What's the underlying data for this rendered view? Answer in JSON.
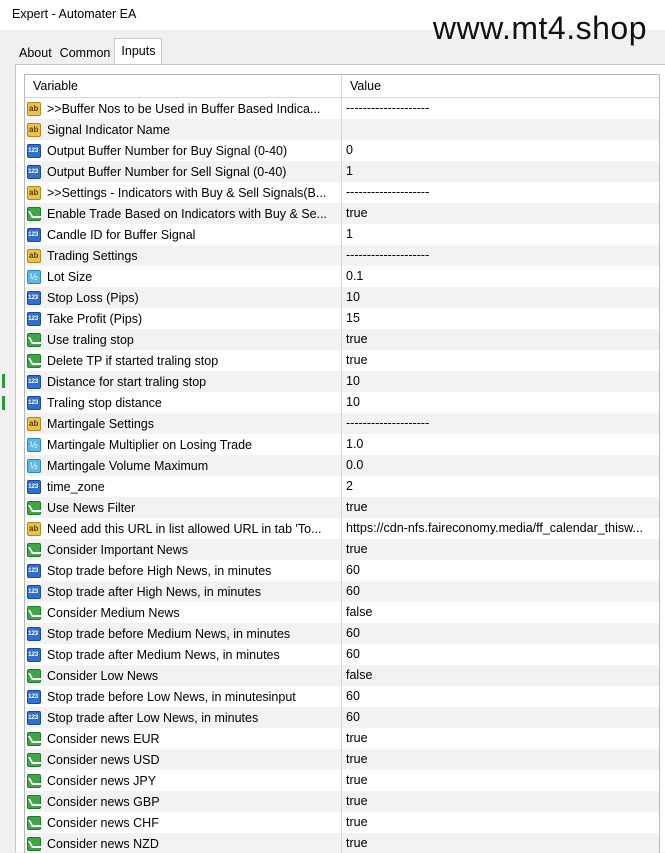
{
  "window": {
    "title": "Expert - Automater EA"
  },
  "watermark": "www.mt4.shop",
  "tabs": [
    {
      "label": "About",
      "active": false
    },
    {
      "label": "Common",
      "active": false
    },
    {
      "label": "Inputs",
      "active": true
    }
  ],
  "table": {
    "headers": {
      "variable": "Variable",
      "value": "Value"
    },
    "rows": [
      {
        "icon": "text",
        "variable": ">>Buffer Nos to be Used in Buffer Based Indica...",
        "value": "--------------------"
      },
      {
        "icon": "text",
        "variable": "Signal Indicator Name",
        "value": ""
      },
      {
        "icon": "int",
        "variable": "Output Buffer Number for Buy Signal (0-40)",
        "value": "0"
      },
      {
        "icon": "int",
        "variable": "Output Buffer Number for Sell Signal (0-40)",
        "value": "1"
      },
      {
        "icon": "text",
        "variable": ">>Settings - Indicators with Buy & Sell Signals(B...",
        "value": "--------------------"
      },
      {
        "icon": "bool",
        "variable": "Enable Trade Based on Indicators with Buy & Se...",
        "value": "true"
      },
      {
        "icon": "int",
        "variable": "Candle ID for Buffer Signal",
        "value": "1"
      },
      {
        "icon": "text",
        "variable": "Trading Settings",
        "value": "--------------------"
      },
      {
        "icon": "double",
        "variable": "Lot Size",
        "value": "0.1"
      },
      {
        "icon": "int",
        "variable": "Stop Loss (Pips)",
        "value": "10"
      },
      {
        "icon": "int",
        "variable": "Take Profit (Pips)",
        "value": "15"
      },
      {
        "icon": "bool",
        "variable": "Use traling stop",
        "value": "true"
      },
      {
        "icon": "bool",
        "variable": "Delete TP if started traling stop",
        "value": "true"
      },
      {
        "icon": "int",
        "variable": "Distance for start traling stop",
        "value": "10"
      },
      {
        "icon": "int",
        "variable": "Traling stop distance",
        "value": "10"
      },
      {
        "icon": "text",
        "variable": "Martingale Settings",
        "value": "--------------------"
      },
      {
        "icon": "double",
        "variable": "Martingale Multiplier on Losing Trade",
        "value": "1.0"
      },
      {
        "icon": "double",
        "variable": "Martingale Volume Maximum",
        "value": "0.0"
      },
      {
        "icon": "int",
        "variable": "time_zone",
        "value": "2"
      },
      {
        "icon": "bool",
        "variable": "Use News Filter",
        "value": "true"
      },
      {
        "icon": "text",
        "variable": "Need add this URL in list allowed URL in tab 'To...",
        "value": "https://cdn-nfs.faireconomy.media/ff_calendar_thisw..."
      },
      {
        "icon": "bool",
        "variable": "Consider Important News",
        "value": "true"
      },
      {
        "icon": "int",
        "variable": "Stop trade before High News, in minutes",
        "value": "60"
      },
      {
        "icon": "int",
        "variable": "Stop trade after High News, in minutes",
        "value": "60"
      },
      {
        "icon": "bool",
        "variable": "Consider Medium News",
        "value": "false"
      },
      {
        "icon": "int",
        "variable": "Stop trade before Medium News, in minutes",
        "value": "60"
      },
      {
        "icon": "int",
        "variable": "Stop trade after Medium News, in minutes",
        "value": "60"
      },
      {
        "icon": "bool",
        "variable": "Consider Low News",
        "value": "false"
      },
      {
        "icon": "int",
        "variable": "Stop trade before Low News, in minutesinput",
        "value": "60"
      },
      {
        "icon": "int",
        "variable": "Stop trade after Low News, in minutes",
        "value": "60"
      },
      {
        "icon": "bool",
        "variable": "Consider news EUR",
        "value": "true"
      },
      {
        "icon": "bool",
        "variable": "Consider news USD",
        "value": "true"
      },
      {
        "icon": "bool",
        "variable": "Consider news JPY",
        "value": "true"
      },
      {
        "icon": "bool",
        "variable": "Consider news GBP",
        "value": "true"
      },
      {
        "icon": "bool",
        "variable": "Consider news CHF",
        "value": "true"
      },
      {
        "icon": "bool",
        "variable": "Consider news NZD",
        "value": "true"
      }
    ]
  }
}
